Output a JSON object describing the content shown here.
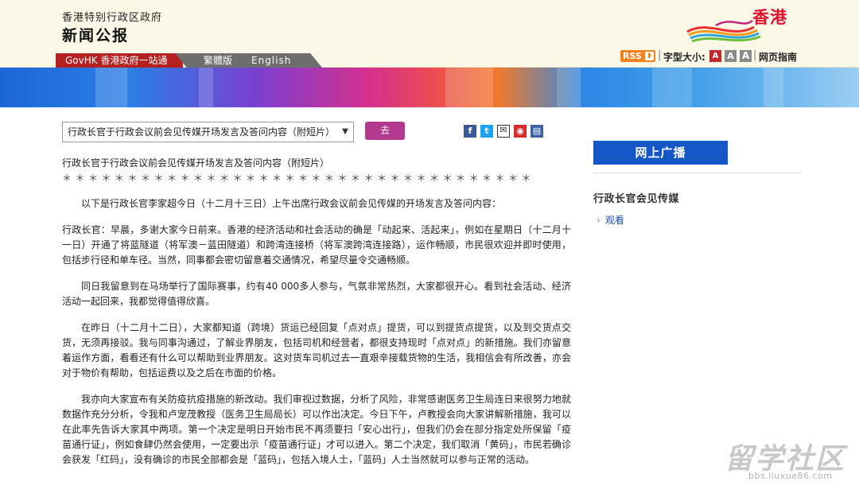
{
  "header": {
    "gov_name": "香港特别行政区政府",
    "site_title": "新闻公报",
    "logo_text": "香港",
    "nav": {
      "govhk": "GovHK 香港政府一站通",
      "traditional": "繁體版",
      "english": "English"
    },
    "tools": {
      "rss": "RSS",
      "font_size_label": "字型大小:",
      "font_small": "A",
      "font_medium": "A",
      "font_large": "A",
      "page_guide": "网页指南"
    }
  },
  "selector": {
    "selected": "行政长官于行政会议前会见传媒开场发言及答问内容（附短片）",
    "go_label": "去"
  },
  "share_icons": [
    "facebook-icon",
    "twitter-icon",
    "mail-icon",
    "weibo-icon",
    "print-icon"
  ],
  "article": {
    "title": "行政长官于行政会议前会见传媒开场发言及答问内容（附短片）",
    "stars": "＊＊＊＊＊＊＊＊＊＊＊＊＊＊＊＊＊＊＊＊＊＊＊＊＊＊＊＊＊＊＊＊＊＊＊＊",
    "p1": "以下是行政长官李家超今日（十二月十三日）上午出席行政会议前会见传媒的开场发言及答问内容：",
    "p2": "行政长官：早晨，多谢大家今日前来。香港的经济活动和社会活动的确是「动起来、活起来」，例如在星期日（十二月十一日）开通了将蓝隧道（将军澳－蓝田隧道）和跨湾连接桥（将军澳跨湾连接路），运作畅顺，市民很欢迎并即时使用，包括步行径和单车径。当然，同事都会密切留意着交通情况，希望尽量令交通畅顺。",
    "p3": "同日我留意到在马场举行了国际赛事，约有40 000多人参与，气氛非常热烈，大家都很开心。看到社会活动、经济活动一起回来，我都觉得值得欣喜。",
    "p4": "在昨日（十二月十二日），大家都知道（跨境）货运已经回复「点对点」提货，可以到提货点提货，以及到交货点交货，无须再接驳。我与同事沟通过，了解业界朋友，包括司机和经营者，都很支持现时「点对点」的新措施。我们亦留意着运作方面，看看还有什么可以帮助到业界朋友。这对货车司机过去一直艰辛接载货物的生活，我相信会有所改善，亦会对于物价有帮助，包括运费以及之后在市面的价格。",
    "p5": "我亦向大家宣布有关防疫抗疫措施的新改动。我们审视过数据，分析了风险，非常感谢医务卫生局连日来很努力地就数据作充分分析，令我和卢宠茂教授（医务卫生局局长）可以作出决定。今日下午，卢教授会向大家讲解新措施，我可以在此率先告诉大家其中两项。第一个决定是明日开始市民不再须要扫「安心出行」，但我们仍会在部分指定处所保留「疫苗通行证」，例如食肆仍然会使用，一定要出示「疫苗通行证」才可以进入。第二个决定，我们取消「黄码」，市民若确诊会获发「红码」，没有确诊的市民全部都会是「蓝码」，包括入境人士，「蓝码」人士当然就可以参与正常的活动。"
  },
  "sidebar": {
    "broadcast_label": "网上广播",
    "section_title": "行政长官会见传媒",
    "watch_link": "观看"
  },
  "watermark": {
    "main": "留学社区",
    "sub": "bbs.liuxue86.com"
  },
  "colors": {
    "header_bg": "#fbf8e8",
    "govhk_red": "#b52020",
    "go_button": "#b33a8f",
    "broadcast_blue": "#1556c8",
    "link_blue": "#1a4fa8"
  }
}
